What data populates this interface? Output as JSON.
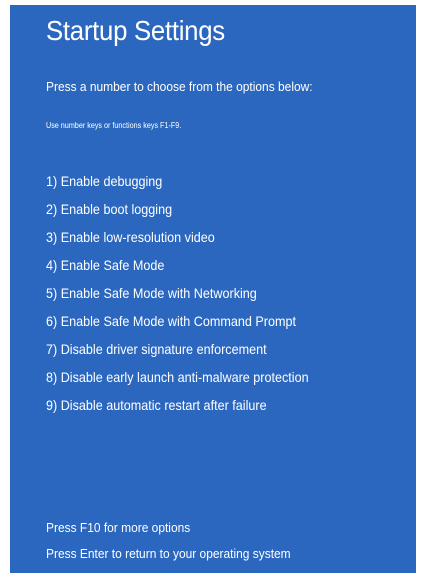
{
  "screen": {
    "title": "Startup Settings",
    "prompt": "Press a number to choose from the options below:",
    "hint": "Use number keys or functions keys F1-F9.",
    "background_color": "#2b67bf",
    "text_color": "#ffffff"
  },
  "options": [
    "1) Enable debugging",
    "2) Enable boot logging",
    "3) Enable low-resolution video",
    "4) Enable Safe Mode",
    "5) Enable Safe Mode with Networking",
    "6) Enable Safe Mode with Command Prompt",
    "7) Disable driver signature enforcement",
    "8) Disable early launch anti-malware protection",
    "9) Disable automatic restart after failure"
  ],
  "footer": {
    "more_options": "Press F10 for more options",
    "return_os": "Press Enter to return to your operating system"
  }
}
